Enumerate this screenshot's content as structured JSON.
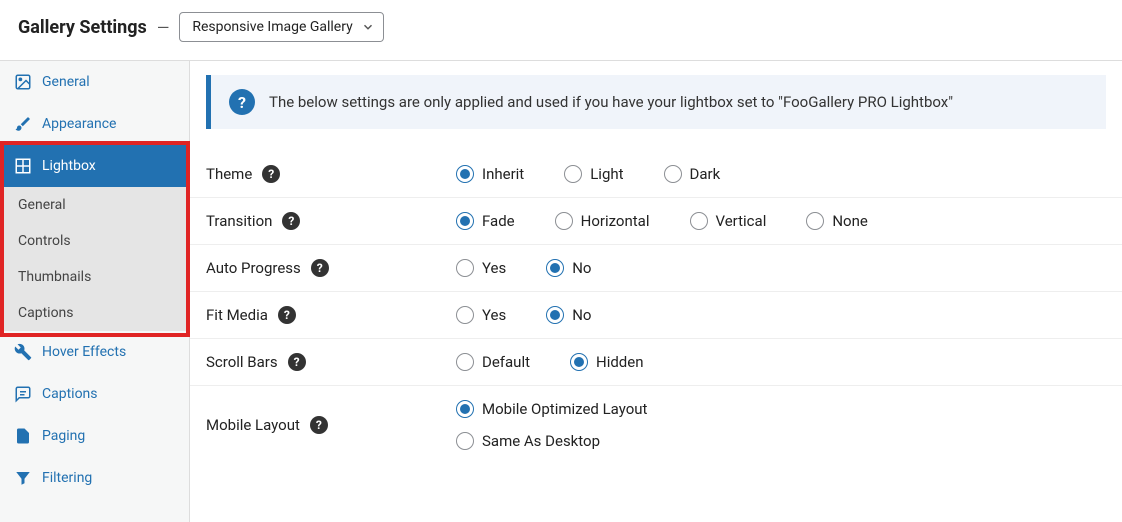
{
  "header": {
    "title": "Gallery Settings",
    "select_value": "Responsive Image Gallery"
  },
  "notice": "The below settings are only applied and used if you have your lightbox set to \"FooGallery PRO Lightbox\"",
  "sidebar": {
    "items": [
      {
        "label": "General"
      },
      {
        "label": "Appearance"
      },
      {
        "label": "Lightbox"
      },
      {
        "label": "Hover Effects"
      },
      {
        "label": "Captions"
      },
      {
        "label": "Paging"
      },
      {
        "label": "Filtering"
      }
    ],
    "sub": [
      {
        "label": "General"
      },
      {
        "label": "Controls"
      },
      {
        "label": "Thumbnails"
      },
      {
        "label": "Captions"
      }
    ]
  },
  "options": {
    "theme": {
      "label": "Theme",
      "opts": [
        "Inherit",
        "Light",
        "Dark"
      ],
      "selected": 0
    },
    "transition": {
      "label": "Transition",
      "opts": [
        "Fade",
        "Horizontal",
        "Vertical",
        "None"
      ],
      "selected": 0
    },
    "autoprogress": {
      "label": "Auto Progress",
      "opts": [
        "Yes",
        "No"
      ],
      "selected": 1
    },
    "fitmedia": {
      "label": "Fit Media",
      "opts": [
        "Yes",
        "No"
      ],
      "selected": 1
    },
    "scrollbars": {
      "label": "Scroll Bars",
      "opts": [
        "Default",
        "Hidden"
      ],
      "selected": 1
    },
    "mobilelayout": {
      "label": "Mobile Layout",
      "opts": [
        "Mobile Optimized Layout",
        "Same As Desktop"
      ],
      "selected": 0
    }
  }
}
